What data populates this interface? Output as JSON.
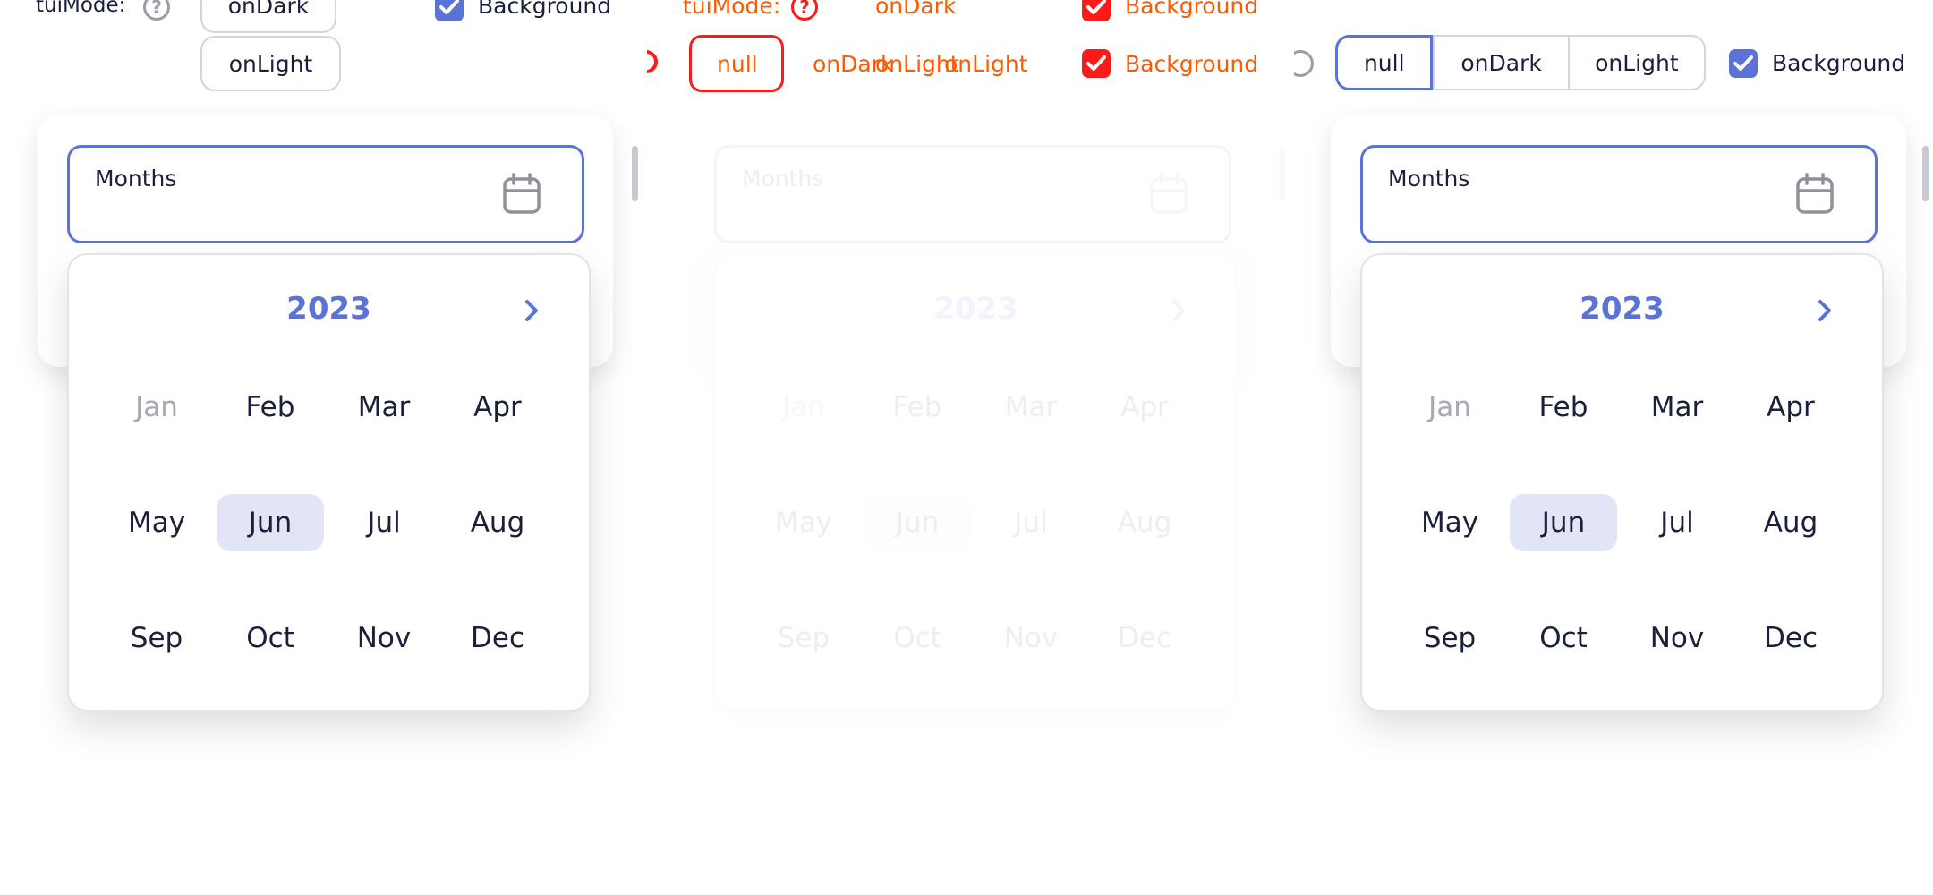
{
  "toolbar": {
    "mode_label": "tuiMode:",
    "help_glyph": "?",
    "mode_options": [
      "null",
      "onDark",
      "onLight"
    ],
    "selected_mode": "null",
    "background_label": "Background",
    "background_checked": true
  },
  "field": {
    "label": "Months",
    "icon": "calendar-icon"
  },
  "calendar": {
    "year": "2023",
    "next_icon": "chevron-right-icon",
    "months": [
      "Jan",
      "Feb",
      "Mar",
      "Apr",
      "May",
      "Jun",
      "Jul",
      "Aug",
      "Sep",
      "Oct",
      "Nov",
      "Dec"
    ],
    "disabled_month": "Jan",
    "selected_month": "Jun"
  },
  "colors": {
    "accent": "#5b73d6",
    "selected_bg": "#e2e5f6",
    "text": "#1b1f3b",
    "muted": "#a7a9b4",
    "debug_outline": "#ff1a1a",
    "debug_text": "#ff5a00"
  }
}
